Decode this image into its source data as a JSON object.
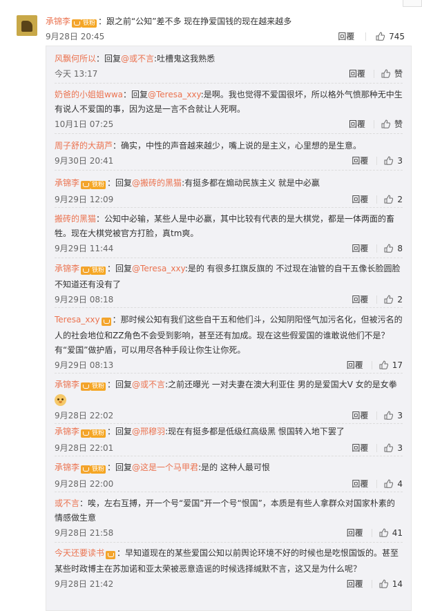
{
  "main_comment": {
    "user": "承锦李",
    "fan_badge": "铁粉",
    "colon": "：",
    "text": "跟之前“公知”差不多 现在挣爱国钱的现在越来越多",
    "time": "9月28日 20:45",
    "reply_label": "回覆",
    "likes": "745"
  },
  "replies": [
    {
      "user": "风飘何所以",
      "fan_badge": "",
      "pre": "：回复",
      "mention": "@或不言",
      "rest": ":吐槽鬼这我熟悉",
      "time": "今天 13:17",
      "reply_label": "回覆",
      "likes": "赞"
    },
    {
      "user": "奶爸的小姐姐wwa",
      "fan_badge": "",
      "pre": "：回复",
      "mention": "@Teresa_xxy",
      "rest": ":是啊。我也觉得不爱国很坏，所以格外气愤那种无中生有说人不爱国的事，因为这是一言不合就让人死啊。",
      "time": "10月1日 07:25",
      "reply_label": "回覆",
      "likes": "赞"
    },
    {
      "user": "周子舒的大葫芦",
      "fan_badge": "",
      "pre": "：确实，中性的声音越来越少，嘴上说的是主义，心里想的是生意。",
      "mention": "",
      "rest": "",
      "time": "9月30日 20:41",
      "reply_label": "回覆",
      "likes": "3"
    },
    {
      "user": "承锦李",
      "fan_badge": "铁粉",
      "pre": "：回复",
      "mention": "@搬砖的黑猫",
      "rest": ":有挺多都在煽动民族主义 就是中必赢",
      "time": "9月29日 12:09",
      "reply_label": "回覆",
      "likes": "2"
    },
    {
      "user": "搬砖的黑猫",
      "fan_badge": "",
      "pre": "：公知中必输，某些人是中必赢，其中比较有代表的是大棋党，都是一体两面的畜牲。现在大棋党被官方打脸，真tm爽。",
      "mention": "",
      "rest": "",
      "time": "9月29日 11:44",
      "reply_label": "回覆",
      "likes": "8"
    },
    {
      "user": "承锦李",
      "fan_badge": "铁粉",
      "pre": "：回复",
      "mention": "@Teresa_xxy",
      "rest": ":是的 有很多扛旗反旗的 不过现在油管的自干五像长脸圆脸不知道还有没有了",
      "time": "9月29日 08:18",
      "reply_label": "回覆",
      "likes": "2"
    },
    {
      "user": "Teresa_xxy",
      "fan_badge": "",
      "pre": "：那时候公知有我们这些自干五和他们斗，公知阴阳怪气加污名化，但被污名的人的社会地位和ZZ角色不会受到影响，甚至还有加成。现在这些假爱国的谁敢说他们不是？有“爱国”做护盾，可以用尽各种手段让你生让你死。",
      "mention": "",
      "rest": "",
      "time": "9月29日 08:13",
      "reply_label": "回覆",
      "likes": "17"
    },
    {
      "user": "承锦李",
      "fan_badge": "铁粉",
      "pre": "：回复",
      "mention": "@或不言",
      "rest": ":之前还曝光 一对夫妻在澳大利亚住 男的是爱国大V 女的是女拳",
      "time": "9月28日 22:02",
      "reply_label": "回覆",
      "likes": "3"
    },
    {
      "user": "承锦李",
      "fan_badge": "铁粉",
      "pre": "：回复",
      "mention": "@邢穆羽",
      "rest": ":现在有挺多都是低级红高级黑 恨国转入地下罢了",
      "time": "9月28日 22:01",
      "reply_label": "回覆",
      "likes": "3"
    },
    {
      "user": "承锦李",
      "fan_badge": "铁粉",
      "pre": "：回复",
      "mention": "@这是一个马甲君",
      "rest": ":是的 这种人最可恨",
      "time": "9月28日 22:00",
      "reply_label": "回覆",
      "likes": "4"
    },
    {
      "user": "或不言",
      "fan_badge": "",
      "pre": "：唉，左右互搏，开一个号“爱国”开一个号“恨国”，本质是有些人拿群众对国家朴素的情感做生意",
      "mention": "",
      "rest": "",
      "time": "9月28日 21:58",
      "reply_label": "回覆",
      "likes": "41"
    },
    {
      "user": "今天还要读书",
      "fan_badge": "",
      "pre": "：早知道现在的某些爱国公知以前舆论环境不好的时候也是吃恨国饭的。甚至某些时政博主在苏加诺和亚太荣被恶意造谣的时候选择缄默不言，这又是为什么呢？",
      "mention": "",
      "rest": "",
      "time": "9月28日 21:42",
      "reply_label": "回覆",
      "likes": "14"
    }
  ]
}
